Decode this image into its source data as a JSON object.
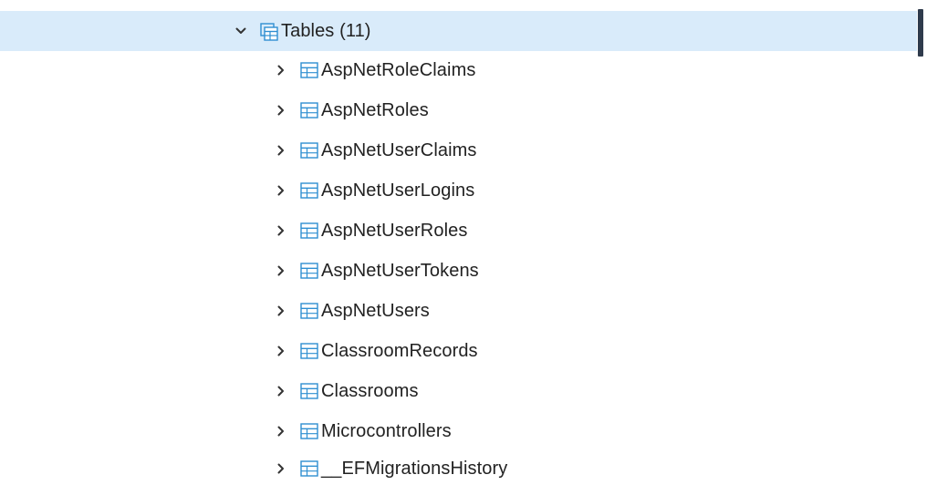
{
  "colors": {
    "selected_bg": "#d9ebfa",
    "icon_blue": "#2f8fd1",
    "scrollbar": "#2f3b4c"
  },
  "tree": {
    "group": {
      "label": "Tables (11)",
      "expanded": true,
      "icon": "tables-group-icon"
    },
    "items": [
      {
        "label": "AspNetRoleClaims",
        "icon": "table-icon"
      },
      {
        "label": "AspNetRoles",
        "icon": "table-icon"
      },
      {
        "label": "AspNetUserClaims",
        "icon": "table-icon"
      },
      {
        "label": "AspNetUserLogins",
        "icon": "table-icon"
      },
      {
        "label": "AspNetUserRoles",
        "icon": "table-icon"
      },
      {
        "label": "AspNetUserTokens",
        "icon": "table-icon"
      },
      {
        "label": "AspNetUsers",
        "icon": "table-icon"
      },
      {
        "label": "ClassroomRecords",
        "icon": "table-icon"
      },
      {
        "label": "Classrooms",
        "icon": "table-icon"
      },
      {
        "label": "Microcontrollers",
        "icon": "table-icon"
      },
      {
        "label": "__EFMigrationsHistory",
        "icon": "table-icon"
      }
    ]
  }
}
